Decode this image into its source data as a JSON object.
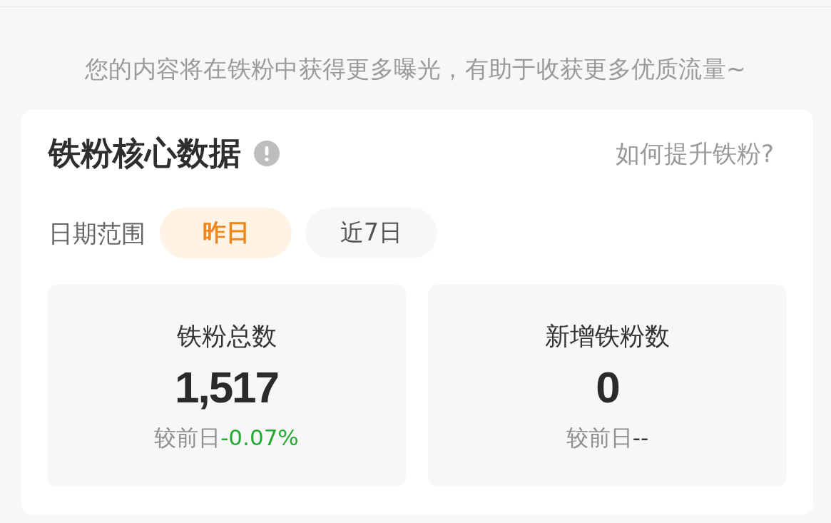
{
  "notice": "您的内容将在铁粉中获得更多曝光，有助于收获更多优质流量~",
  "card": {
    "title": "铁粉核心数据",
    "help_link": "如何提升铁粉?",
    "date_range": {
      "label": "日期范围",
      "tabs": [
        {
          "label": "昨日",
          "selected": true
        },
        {
          "label": "近7日",
          "selected": false
        }
      ]
    },
    "stats": [
      {
        "label": "铁粉总数",
        "value": "1,517",
        "compare_label": "较前日",
        "change": "-0.07%",
        "color": "#22aa33"
      },
      {
        "label": "新增铁粉数",
        "value": "0",
        "compare_label": "较前日",
        "change": "--",
        "color": "#333333"
      }
    ]
  }
}
